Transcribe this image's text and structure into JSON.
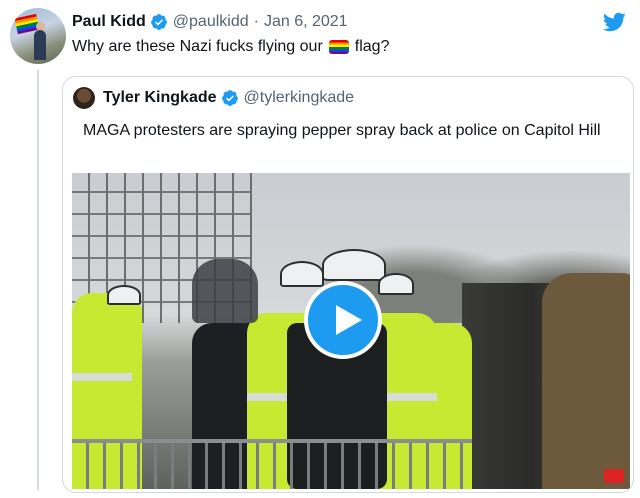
{
  "tweet": {
    "author_name": "Paul Kidd",
    "author_handle": "@paulkidd",
    "separator": "·",
    "date": "Jan 6, 2021",
    "text_before": "Why are these Nazi fucks flying our",
    "text_after": "flag?"
  },
  "quoted_tweet": {
    "author_name": "Tyler Kingkade",
    "author_handle": "@tylerkingkade",
    "text": "MAGA protesters are spraying pepper spray back at police on Capitol Hill"
  },
  "icons": {
    "verified": "verified-badge-icon",
    "brand": "twitter-bird-icon",
    "play": "play-icon",
    "flag_emoji": "rainbow-flag-icon"
  },
  "colors": {
    "twitter_blue": "#1d9bf0",
    "secondary_text": "#536471",
    "border": "#cfd9de"
  }
}
